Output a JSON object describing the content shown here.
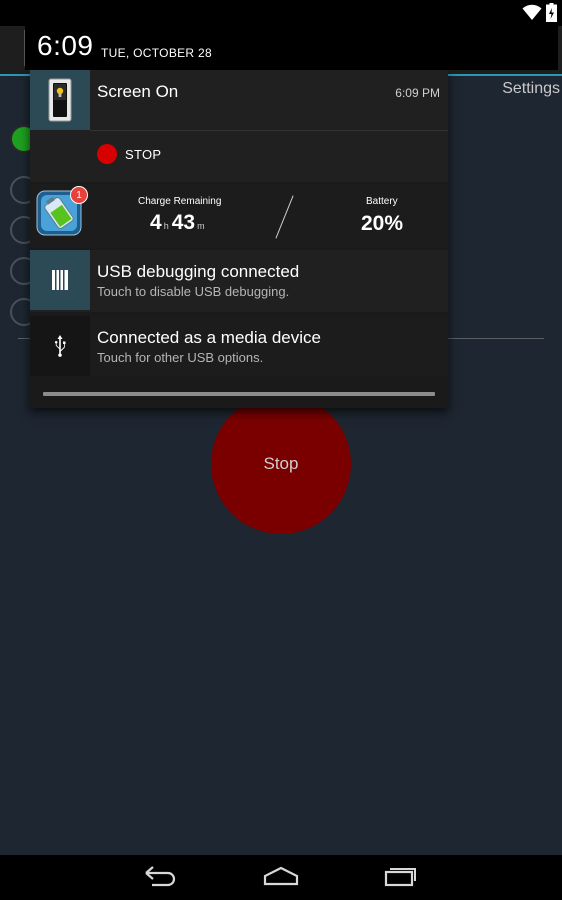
{
  "status_bar": {
    "wifi_icon": "wifi-icon",
    "battery_icon": "battery-charging-icon"
  },
  "shade_header": {
    "time": "6:09",
    "date": "TUE, OCTOBER 28"
  },
  "app": {
    "settings_label": "Settings",
    "stop_button_label": "Stop"
  },
  "notifications": {
    "screen_on": {
      "title": "Screen On",
      "time": "6:09 PM",
      "action_label": "STOP",
      "icon": "light-switch-icon"
    },
    "battery": {
      "badge": "1",
      "charge_label": "Charge Remaining",
      "hours": "4",
      "hours_unit": "h",
      "minutes": "43",
      "minutes_unit": "m",
      "battery_label": "Battery",
      "battery_value": "20%",
      "icon": "battery-app-icon"
    },
    "usb_debugging": {
      "title": "USB debugging connected",
      "subtitle": "Touch to disable USB debugging.",
      "icon": "usb-debug-icon"
    },
    "media_device": {
      "title": "Connected as a media device",
      "subtitle": "Touch for other USB options.",
      "icon": "usb-icon"
    }
  },
  "navbar": {
    "back": "back-icon",
    "home": "home-icon",
    "recent": "recent-apps-icon"
  },
  "colors": {
    "accent": "#2a97b3",
    "stop_red": "#d60000",
    "stop_circle": "#7a0000",
    "app_bg": "#1e2631"
  }
}
